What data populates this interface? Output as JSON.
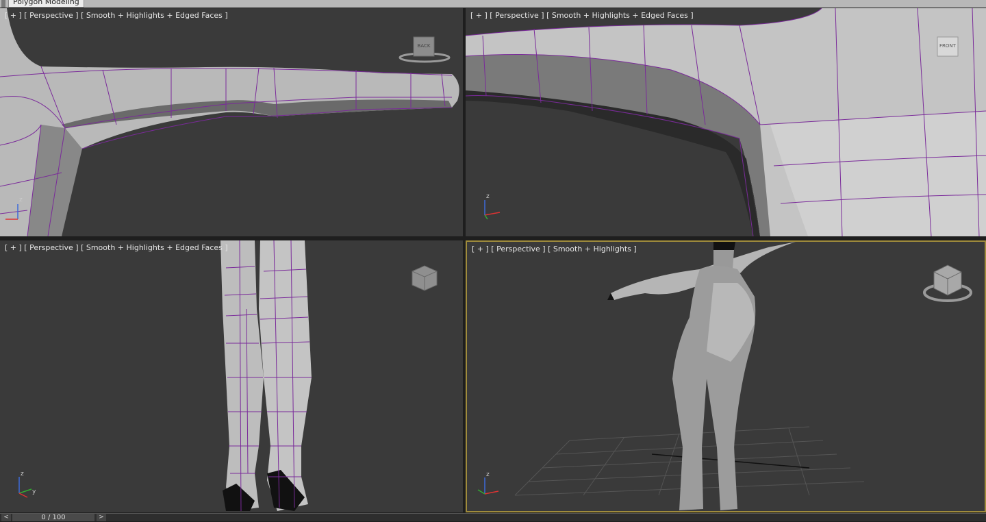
{
  "ribbon": {
    "tab_label": "Polygon Modeling"
  },
  "viewports": [
    {
      "label": "[ + ] [ Perspective ] [ Smooth + Highlights + Edged Faces ]",
      "navcube_face": "BACK"
    },
    {
      "label": "[ + ] [ Perspective ] [ Smooth + Highlights + Edged Faces ]",
      "navcube_face": "FRONT"
    },
    {
      "label": "[ + ] [ Perspective ] [ Smooth + Highlights + Edged Faces ]",
      "navcube_face": ""
    },
    {
      "label": "[ + ] [ Perspective ] [ Smooth + Highlights ]",
      "navcube_face": ""
    }
  ],
  "axes": {
    "x": "x",
    "y": "y",
    "z": "z"
  },
  "timeline": {
    "frame": "0 / 100",
    "prev": "<",
    "next": ">"
  },
  "colors": {
    "viewport_bg": "#3a3a3a",
    "edge_color": "#7a2a9a",
    "active_border": "#a08c3c"
  }
}
